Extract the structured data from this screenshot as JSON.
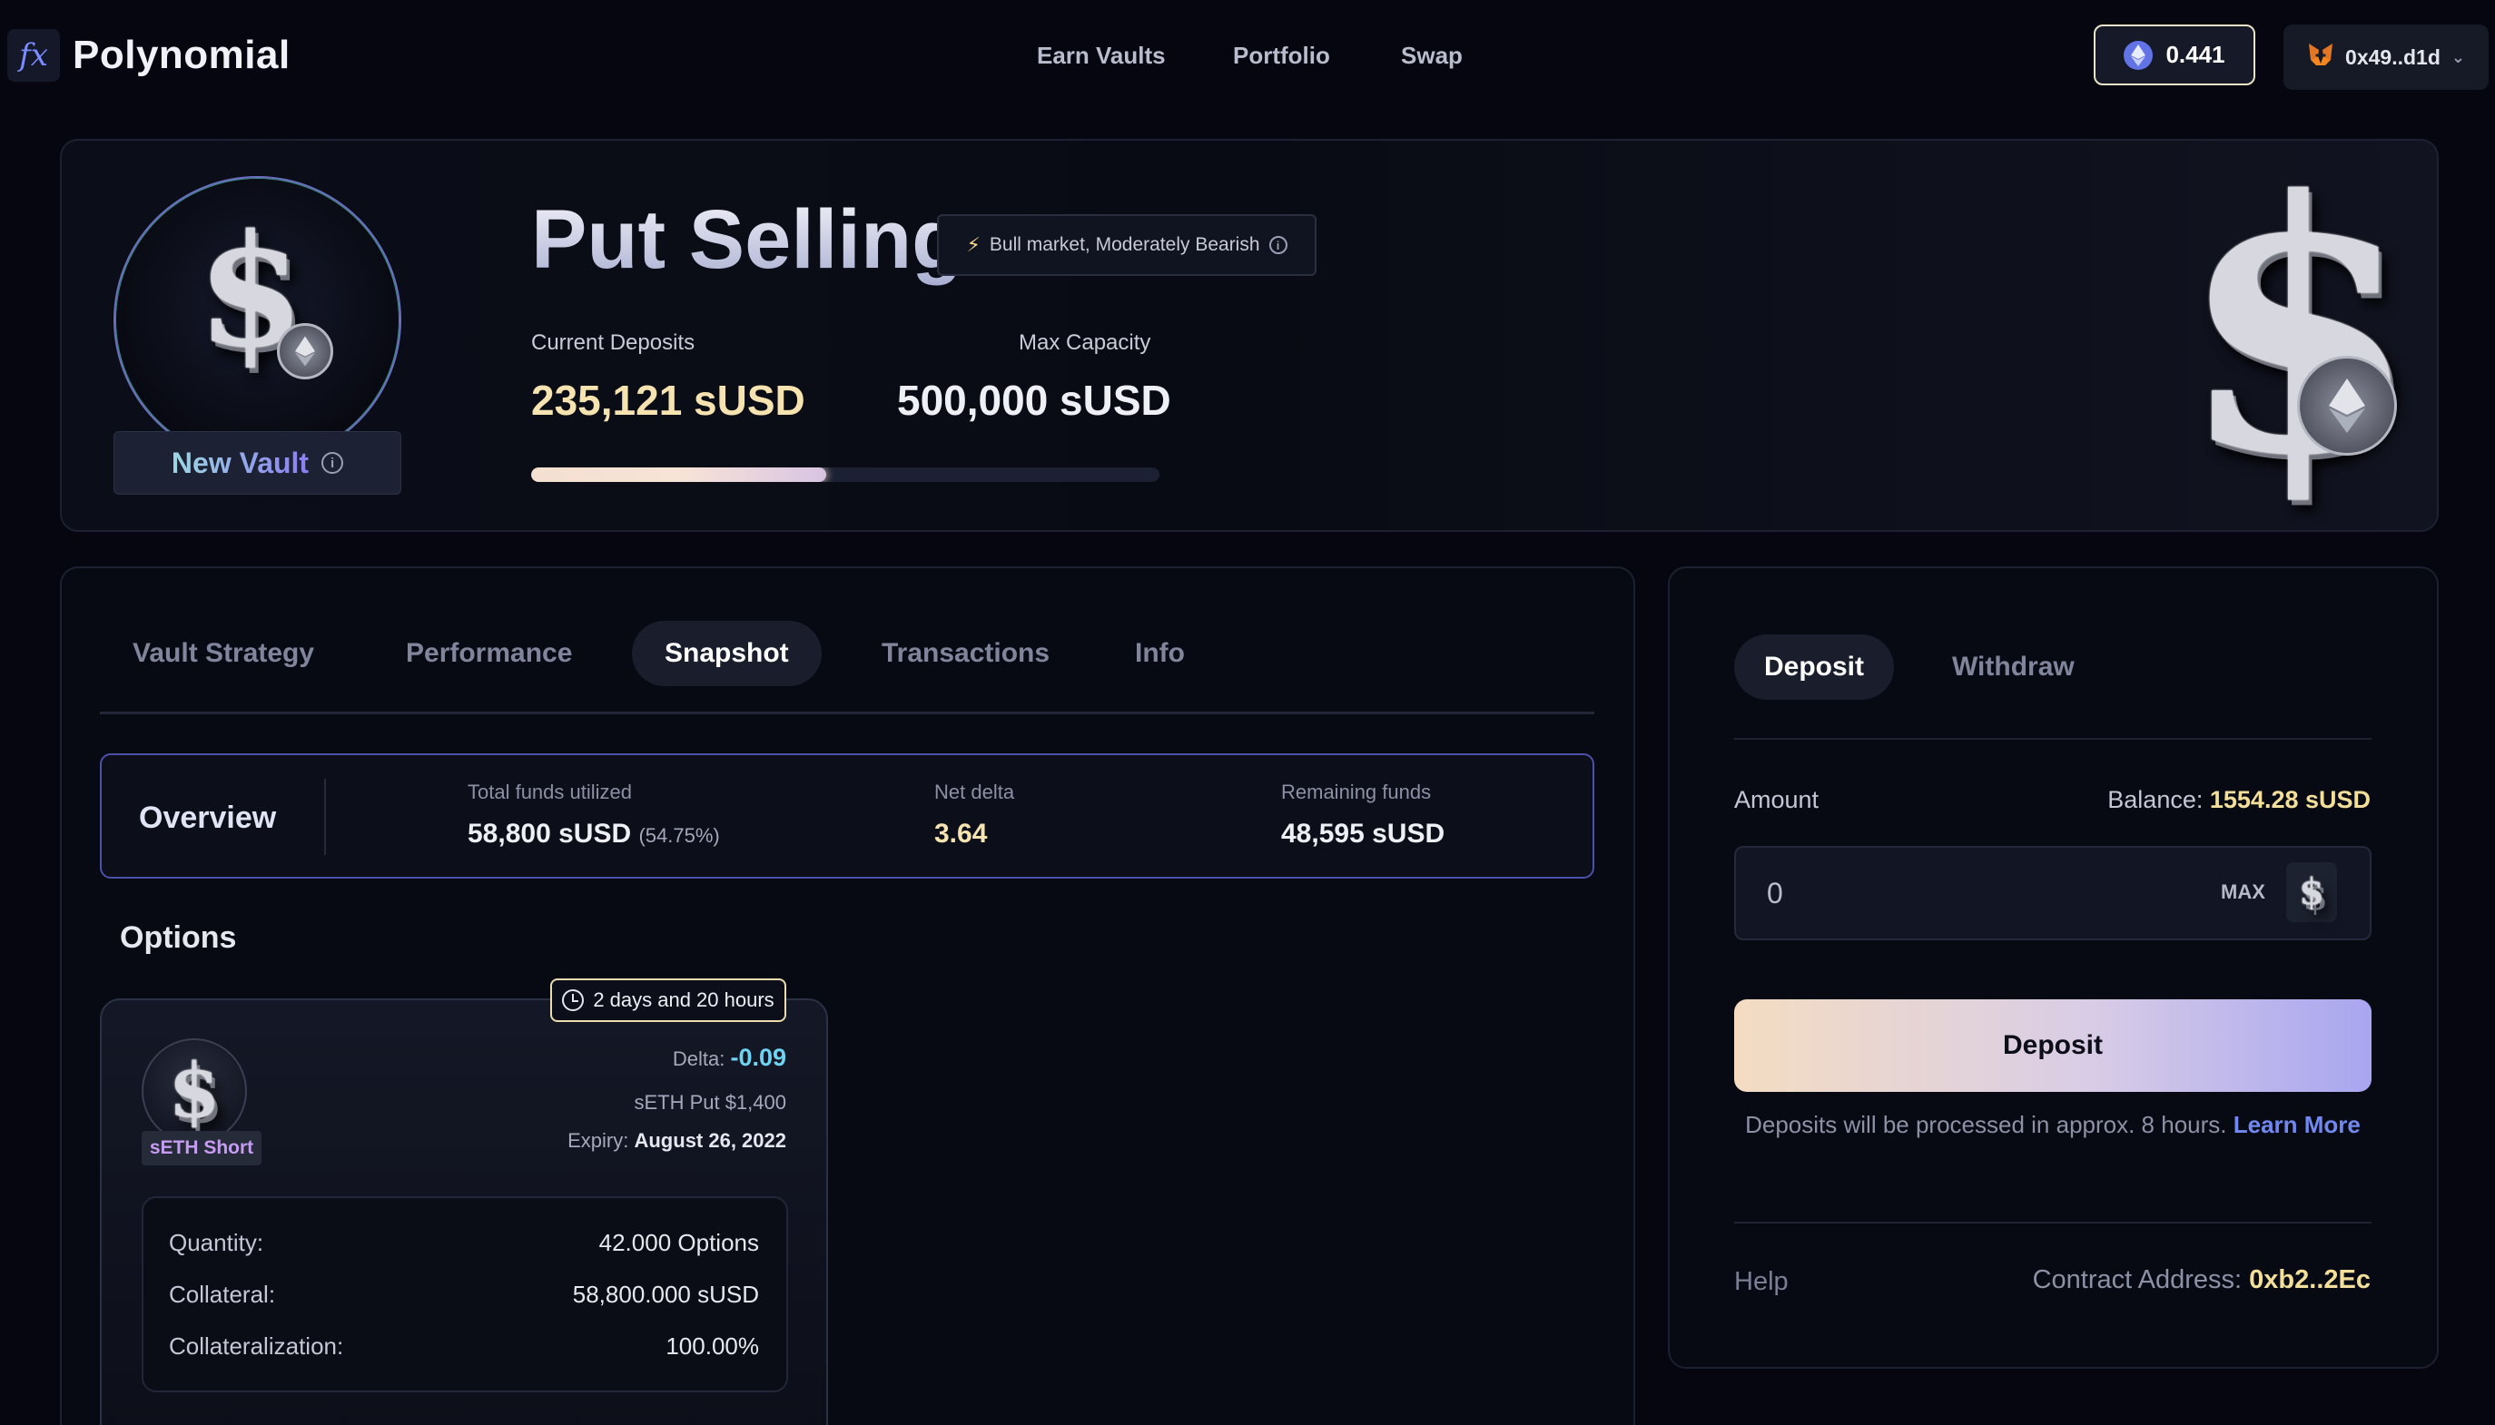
{
  "header": {
    "logo_text": "fx",
    "brand": "Polynomial",
    "nav": [
      "Earn Vaults",
      "Portfolio",
      "Swap"
    ],
    "eth_balance": "0.441",
    "wallet": "0x49..d1d"
  },
  "hero": {
    "badge": "New Vault",
    "title": "Put Selling",
    "tag": "Bull market, Moderately Bearish",
    "current_deposits_label": "Current Deposits",
    "current_deposits": "235,121 sUSD",
    "max_capacity_label": "Max Capacity",
    "max_capacity": "500,000 sUSD",
    "fill_fraction": 0.47
  },
  "tabs": [
    "Vault Strategy",
    "Performance",
    "Snapshot",
    "Transactions",
    "Info"
  ],
  "active_tab": "Snapshot",
  "overview": {
    "title": "Overview",
    "total_funds_label": "Total funds utilized",
    "total_funds": "58,800 sUSD",
    "total_funds_pct": "(54.75%)",
    "net_delta_label": "Net delta",
    "net_delta": "3.64",
    "remaining_label": "Remaining funds",
    "remaining": "48,595 sUSD"
  },
  "options": {
    "heading": "Options",
    "card": {
      "timer": "2 days and 20 hours",
      "tag": "sETH Short",
      "delta_label": "Delta:",
      "delta": "-0.09",
      "instrument": "sETH Put $1,400",
      "expiry_label": "Expiry:",
      "expiry": "August 26, 2022",
      "rows": [
        {
          "label": "Quantity:",
          "value": "42.000 Options"
        },
        {
          "label": "Collateral:",
          "value": "58,800.000 sUSD"
        },
        {
          "label": "Collateralization:",
          "value": "100.00%"
        }
      ]
    }
  },
  "deposit_panel": {
    "tabs": [
      "Deposit",
      "Withdraw"
    ],
    "amount_label": "Amount",
    "balance_label": "Balance:",
    "balance": "1554.28 sUSD",
    "amount_value": "0",
    "max_label": "MAX",
    "button": "Deposit",
    "note": "Deposits will be processed in approx. 8 hours.",
    "learn_more": "Learn More",
    "help": "Help",
    "contract_label": "Contract Address:",
    "contract": "0xb2..2Ec"
  },
  "colors": {
    "accent_gold": "#f6e3b0",
    "accent_purple": "#4c50a8",
    "delta_blue": "#6fd3f2",
    "link_blue": "#7088f0"
  }
}
